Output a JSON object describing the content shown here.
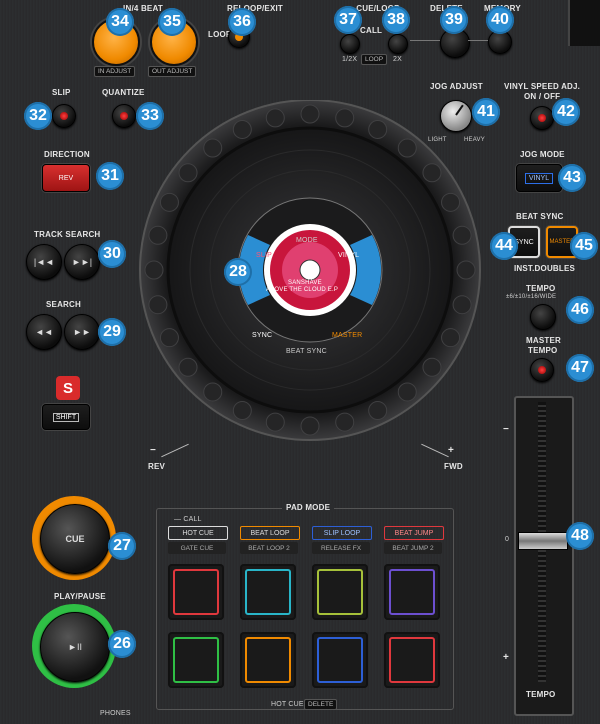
{
  "header": {
    "loop_in_label": "IN/4 BEAT",
    "loop_in_sub": "IN ADJUST",
    "loop_out_sub": "OUT ADJUST",
    "reloop_label": "RELOOP/EXIT",
    "loop_label": "LOOP",
    "cue_loop_call_label": "CUE/LOOP",
    "call_label": "CALL",
    "half_label": "1/2X",
    "loop_pill": "LOOP",
    "double_label": "2X",
    "delete_label": "DELETE",
    "memory_label": "MEMORY"
  },
  "controls": {
    "slip_label": "SLIP",
    "quantize_label": "QUANTIZE",
    "direction_label": "DIRECTION",
    "rev_button": "REV",
    "track_search_label": "TRACK SEARCH",
    "search_label": "SEARCH",
    "shift_badge": "S",
    "shift_button": "SHIFT"
  },
  "right": {
    "jog_adjust_label": "JOG ADJUST",
    "light_label": "LIGHT",
    "heavy_label": "HEAVY",
    "vinyl_speed_label": "VINYL SPEED ADJ.",
    "vinyl_speed_sub": "ON / OFF",
    "jog_mode_label": "JOG MODE",
    "vinyl_button": "VINYL",
    "beat_sync_label": "BEAT SYNC",
    "sync_button": "SYNC",
    "master_button": "MASTER",
    "inst_doubles_label": "INST.DOUBLES",
    "tempo_label": "TEMPO",
    "tempo_ranges": "±6/±10/±16/WIDE",
    "master_tempo_label": "MASTER",
    "master_tempo_sub": "TEMPO",
    "tempo_slider_label": "TEMPO",
    "tempo_zero": "0",
    "tempo_minus": "−",
    "tempo_plus": "+"
  },
  "jog": {
    "mode_label": "MODE",
    "vinyl_text": "VINYL",
    "slip_text": "SLIP",
    "sync_text": "SYNC",
    "beat_sync_text": "BEAT SYNC",
    "master_text": "MASTER",
    "artist": "SANSHAVE",
    "track": "ABOVE THE CLOUD E.P",
    "rev_label": "REV",
    "fwd_label": "FWD",
    "minus": "−",
    "plus": "+"
  },
  "transport": {
    "cue_label": "CUE",
    "play_pause_label": "PLAY/PAUSE",
    "play_icon": "►II",
    "phones_label": "PHONES"
  },
  "pads": {
    "pad_mode_label": "PAD MODE",
    "call_label": "— CALL",
    "hot_cue": "HOT CUE",
    "beat_loop": "BEAT LOOP",
    "slip_loop": "SLIP LOOP",
    "beat_jump": "BEAT JUMP",
    "gate_cue": "GATE CUE",
    "beat_loop_2": "BEAT LOOP 2",
    "release_fx": "RELEASE FX",
    "beat_jump_2": "BEAT JUMP 2",
    "hot_cue_bottom": "HOT CUE",
    "delete_bottom": "DELETE",
    "colors_top": [
      "#e0383d",
      "#29b5c8",
      "#a6c13a",
      "#6c4fd0"
    ],
    "colors_bottom": [
      "#2fbf45",
      "#f08a00",
      "#2d5fd6",
      "#e0383d"
    ]
  },
  "callouts": {
    "n26": "26",
    "n27": "27",
    "n28": "28",
    "n29": "29",
    "n30": "30",
    "n31": "31",
    "n32": "32",
    "n33": "33",
    "n34": "34",
    "n35": "35",
    "n36": "36",
    "n37": "37",
    "n38": "38",
    "n39": "39",
    "n40": "40",
    "n41": "41",
    "n42": "42",
    "n43": "43",
    "n44": "44",
    "n45": "45",
    "n46": "46",
    "n47": "47",
    "n48": "48"
  }
}
